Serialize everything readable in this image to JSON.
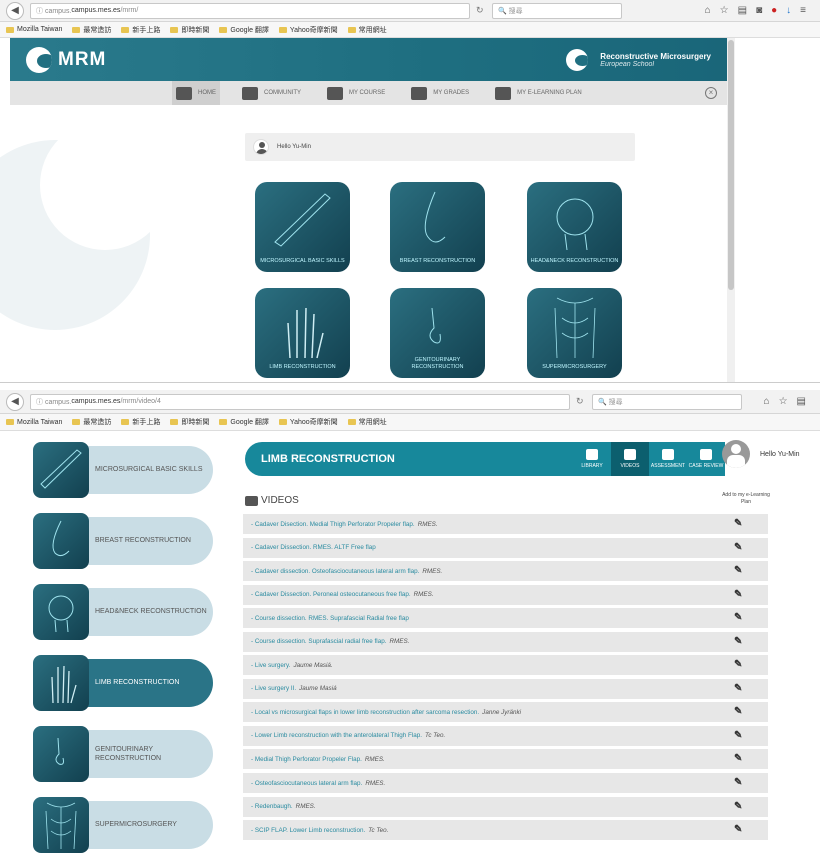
{
  "shot1": {
    "url_host": "campus.mes.es",
    "url_rest": "/mrm/",
    "search_placeholder": "搜尋",
    "bookmarks": [
      "Mozilla Taiwan",
      "最常造訪",
      "新手上路",
      "即時新聞",
      "Google 翻譯",
      "Yahoo奇摩新聞",
      "常用網址"
    ],
    "logo_text": "MRM",
    "brand_line1": "Reconstructive Microsurgery",
    "brand_line2": "European School",
    "nav": [
      {
        "label": "HOME",
        "active": true
      },
      {
        "label": "COMMUNITY",
        "active": false
      },
      {
        "label": "MY COURSE",
        "active": false
      },
      {
        "label": "MY GRADES",
        "active": false
      },
      {
        "label": "MY E-LEARNING PLAN",
        "active": false
      }
    ],
    "hello": "Hello Yu-Min",
    "tiles": [
      {
        "label": "MICROSURGICAL BASIC SKILLS",
        "icon": "scalpel-icon"
      },
      {
        "label": "BREAST RECONSTRUCTION",
        "icon": "breast-icon"
      },
      {
        "label": "HEAD&NECK RECONSTRUCTION",
        "icon": "head-icon"
      },
      {
        "label": "LIMB RECONSTRUCTION",
        "icon": "hand-icon"
      },
      {
        "label": "GENITOURINARY RECONSTRUCTION",
        "icon": "genitourinary-icon"
      },
      {
        "label": "SUPERMICROSURGERY",
        "icon": "torso-icon"
      }
    ]
  },
  "shot2": {
    "url_host": "campus.mes.es",
    "url_rest": "/mrm/video/4",
    "search_placeholder": "搜尋",
    "bookmarks": [
      "Mozilla Taiwan",
      "最常造訪",
      "新手上路",
      "即時新聞",
      "Google 翻譯",
      "Yahoo奇摩新聞",
      "常用網址"
    ],
    "sidebar": [
      {
        "label": "MICROSURGICAL BASIC SKILLS",
        "active": false
      },
      {
        "label": "BREAST RECONSTRUCTION",
        "active": false
      },
      {
        "label": "HEAD&NECK RECONSTRUCTION",
        "active": false
      },
      {
        "label": "LIMB RECONSTRUCTION",
        "active": true
      },
      {
        "label": "GENITOURINARY RECONSTRUCTION",
        "active": false
      },
      {
        "label": "SUPERMICROSURGERY",
        "active": false
      }
    ],
    "section_title": "LIMB RECONSTRUCTION",
    "topnav": [
      {
        "label": "LIBRARY",
        "active": false
      },
      {
        "label": "VIDEOS",
        "active": true
      },
      {
        "label": "ASSESSMENT",
        "active": false
      },
      {
        "label": "CASE REVIEW",
        "active": false
      }
    ],
    "hello": "Hello Yu-Min",
    "videos_heading": "VIDEOS",
    "add_heading": "Add to my e-Learning Plan",
    "videos": [
      {
        "title": "- Cadaver Disection. Medial Thigh Perforator Propeler flap.",
        "author": "RMES."
      },
      {
        "title": "- Cadaver Dissection. RMES. ALTF Free flap",
        "author": ""
      },
      {
        "title": "- Cadaver dissection. Osteofasciocutaneous lateral arm flap.",
        "author": "RMES."
      },
      {
        "title": "- Cadaver Dissection. Peroneal osteocutaneous free flap.",
        "author": "RMES."
      },
      {
        "title": "- Course dissection. RMES. Suprafascial Radial free flap",
        "author": ""
      },
      {
        "title": "- Course dissection. Suprafascial radial free flap.",
        "author": "RMES."
      },
      {
        "title": "- Live surgery.",
        "author": "Jaume Masiá."
      },
      {
        "title": "- Live surgery II.",
        "author": "Jaume Masiá"
      },
      {
        "title": "- Local vs microsurgical flaps in lower limb reconstruction after sarcoma resection.",
        "author": "Janne Jyränki"
      },
      {
        "title": "- Lower Limb reconstruction with the anterolateral Thigh Flap.",
        "author": "Tc Teo."
      },
      {
        "title": "- Medial Thigh Perforator Propeler Flap.",
        "author": "RMES."
      },
      {
        "title": "- Osteofasciocutaneous lateral arm flap.",
        "author": "RMES."
      },
      {
        "title": "- Redenbaugh.",
        "author": "RMES."
      },
      {
        "title": "- SCIP FLAP. Lower Limb reconstruction.",
        "author": "Tc Teo."
      }
    ]
  }
}
